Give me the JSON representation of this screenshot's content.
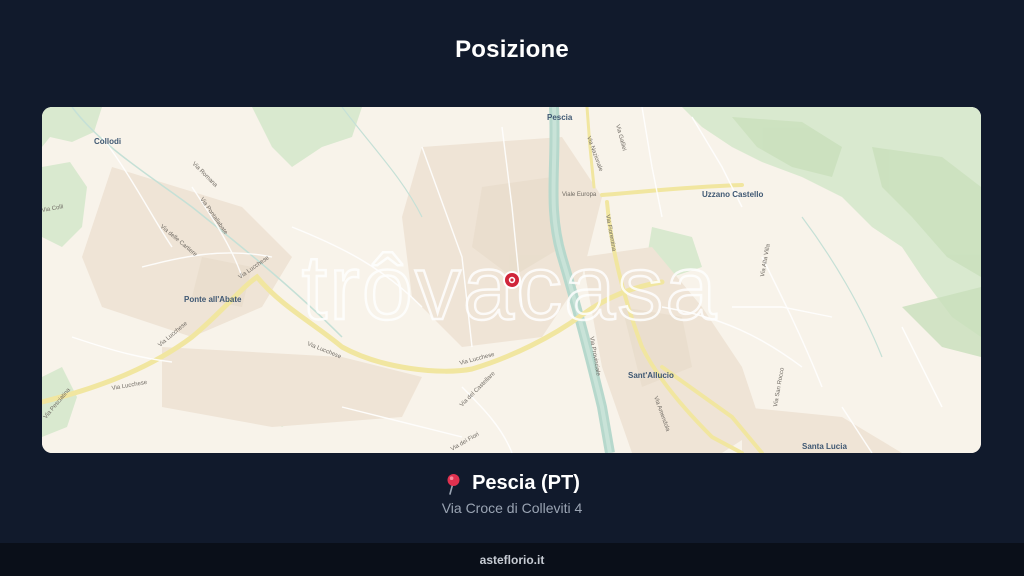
{
  "header": {
    "title": "Posizione"
  },
  "map": {
    "watermark": "trôvacasa",
    "places": {
      "pescia": "Pescia",
      "collodi": "Collodi",
      "uzzano_castello": "Uzzano Castello",
      "ponte_all_abate": "Ponte all'Abate",
      "sant_allucio": "Sant'Allucio",
      "santa_lucia": "Santa Lucia"
    },
    "streets": {
      "via_europa": "Viale Europa",
      "via_lucchese_1": "Via Lucchese",
      "via_lucchese_2": "Via Lucchese",
      "via_lucchese_3": "Via Lucchese",
      "via_lucchese_4": "Via Lucchese",
      "via_lucchese_5": "Via Lucchese",
      "via_delle_cartiere": "Via delle Cartiere",
      "via_romana": "Via Romana",
      "via_pesciatina": "Via Pesciatina",
      "via_fiorentina": "Via Fiorentina",
      "via_dei_fiori": "Via dei Fiori",
      "via_del_castellare": "Via del Castellare",
      "via_ponte_all_abate": "Via Pontallabate",
      "via_nazionale": "Via Nazionale",
      "via_galilei": "Via Galilei",
      "via_colli": "Via Colli",
      "via_alta": "Via Alta Villa",
      "via_san_rocco": "Via San Rocco",
      "via_amendola": "Via Amendola",
      "via_provinciale": "Via Provinciale"
    },
    "marker_icon": "location-marker-icon"
  },
  "location": {
    "pin_icon": "round-pushpin-icon",
    "city": "Pescia (PT)",
    "address": "Via Croce di Colleviti 4"
  },
  "footer": {
    "site": "asteflorio.it"
  },
  "colors": {
    "background": "#111a2c",
    "map_base": "#f8f3ea",
    "forest": "#d6e8cc",
    "water": "#b6d8cc",
    "road_major": "#f3e9a6",
    "marker": "#d0253a"
  }
}
